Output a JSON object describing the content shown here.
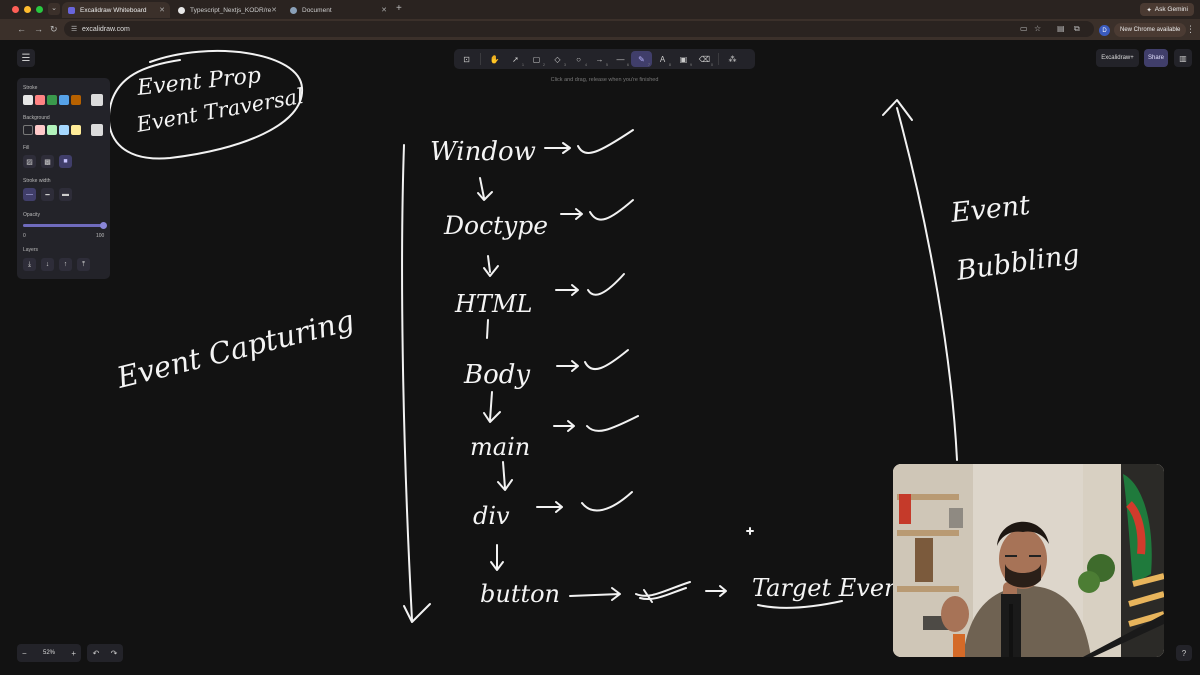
{
  "tabs": [
    {
      "title": "Excalidraw Whiteboard",
      "favicon": "excalidraw-icon",
      "active": true
    },
    {
      "title": "Typescript_Nextjs_KODR/re",
      "favicon": "github-icon",
      "active": false
    },
    {
      "title": "Document",
      "favicon": "globe-icon",
      "active": false
    }
  ],
  "chrome": {
    "url": "excalidraw.com",
    "ask_label": "Ask Gemini",
    "profile_initial": "D",
    "new_chrome_label": "New Chrome available"
  },
  "toolbar": {
    "tools": [
      {
        "name": "lock-tool",
        "icon": "lock-icon",
        "key": ""
      },
      {
        "name": "hand-tool",
        "icon": "hand-icon",
        "key": ""
      },
      {
        "name": "selection-tool",
        "icon": "pointer-icon",
        "key": "1"
      },
      {
        "name": "rectangle-tool",
        "icon": "square-icon",
        "key": "2"
      },
      {
        "name": "diamond-tool",
        "icon": "diamond-icon",
        "key": "3"
      },
      {
        "name": "ellipse-tool",
        "icon": "circle-icon",
        "key": "4"
      },
      {
        "name": "arrow-tool",
        "icon": "arrow-icon",
        "key": "5"
      },
      {
        "name": "line-tool",
        "icon": "line-icon",
        "key": "6"
      },
      {
        "name": "draw-tool",
        "icon": "pencil-icon",
        "key": "7"
      },
      {
        "name": "text-tool",
        "icon": "text-icon",
        "key": "8"
      },
      {
        "name": "image-tool",
        "icon": "image-icon",
        "key": "9"
      },
      {
        "name": "eraser-tool",
        "icon": "eraser-icon",
        "key": "0"
      }
    ],
    "active_tool": "draw-tool",
    "hint": "Click and drag, release when you're finished"
  },
  "top_right": {
    "excalidraw_plus": "Excalidraw+",
    "share": "Share"
  },
  "properties": {
    "stroke_label": "Stroke",
    "stroke_colors": [
      "#e6e6e6",
      "#ff8383",
      "#3a994c",
      "#56a2e8",
      "#b76100",
      "#dcdcdc"
    ],
    "background_label": "Background",
    "background_colors": [
      "transparent",
      "#ffc9c9",
      "#b2f2bb",
      "#a5d8ff",
      "#ffec99",
      "#dcdcdc"
    ],
    "fill_label": "Fill",
    "stroke_width_label": "Stroke width",
    "opacity_label": "Opacity",
    "opacity_min": "0",
    "opacity_max": "100",
    "opacity_value": 100,
    "layers_label": "Layers"
  },
  "zoom": {
    "value": "52%"
  },
  "whiteboard": {
    "note_line1": "Event Prop",
    "note_line2": "Event Traversal",
    "capturing": "Event Capturing",
    "bubbling_line1": "Event",
    "bubbling_line2": "Bubbling",
    "chain": [
      "Window",
      "Doctype",
      "HTML",
      "Body",
      "main",
      "div",
      "button"
    ],
    "target": "Target Event"
  }
}
